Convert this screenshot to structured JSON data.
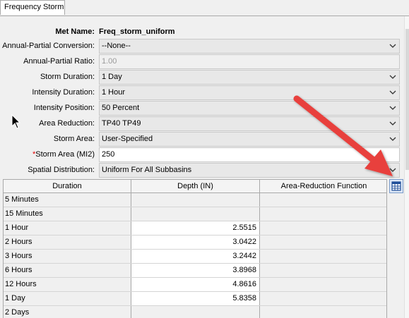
{
  "tab": {
    "label": "Frequency Storm"
  },
  "met_name": {
    "label": "Met Name:",
    "value": "Freq_storm_uniform"
  },
  "fields": [
    {
      "label": "Annual-Partial Conversion:",
      "value": "--None--",
      "type": "dropdown",
      "required": false
    },
    {
      "label": "Annual-Partial Ratio:",
      "value": "1.00",
      "type": "text-disabled",
      "required": false
    },
    {
      "label": "Storm Duration:",
      "value": "1 Day",
      "type": "dropdown",
      "required": false
    },
    {
      "label": "Intensity Duration:",
      "value": "1 Hour",
      "type": "dropdown",
      "required": false
    },
    {
      "label": "Intensity Position:",
      "value": "50 Percent",
      "type": "dropdown",
      "required": false
    },
    {
      "label": "Area Reduction:",
      "value": "TP40 TP49",
      "type": "dropdown",
      "required": false
    },
    {
      "label": "Storm Area:",
      "value": "User-Specified",
      "type": "dropdown",
      "required": false
    },
    {
      "label": "Storm Area (MI2)",
      "value": "250",
      "type": "text",
      "required": true,
      "required_mark": "*"
    },
    {
      "label": "Spatial Distribution:",
      "value": "Uniform For All Subbasins",
      "type": "dropdown",
      "required": false
    }
  ],
  "table": {
    "columns": [
      "Duration",
      "Depth (IN)",
      "Area-Reduction Function"
    ],
    "rows": [
      {
        "duration": "5 Minutes",
        "depth": "",
        "arf": ""
      },
      {
        "duration": "15 Minutes",
        "depth": "",
        "arf": ""
      },
      {
        "duration": "1 Hour",
        "depth": "2.5515",
        "arf": ""
      },
      {
        "duration": "2 Hours",
        "depth": "3.0422",
        "arf": ""
      },
      {
        "duration": "3 Hours",
        "depth": "3.2442",
        "arf": ""
      },
      {
        "duration": "6 Hours",
        "depth": "3.8968",
        "arf": ""
      },
      {
        "duration": "12 Hours",
        "depth": "4.8616",
        "arf": ""
      },
      {
        "duration": "1 Day",
        "depth": "5.8358",
        "arf": ""
      },
      {
        "duration": "2 Days",
        "depth": "",
        "arf": ""
      }
    ]
  },
  "icons": {
    "table_editor_button": "table-grid-icon",
    "dropdown": "chevron-down-icon",
    "annotation": "red-arrow-annotation",
    "cursor": "mouse-pointer-icon"
  },
  "colors": {
    "annotation_red": "#e8413c",
    "required_red": "#e00000",
    "table_button_blue": "#1f4e99"
  }
}
